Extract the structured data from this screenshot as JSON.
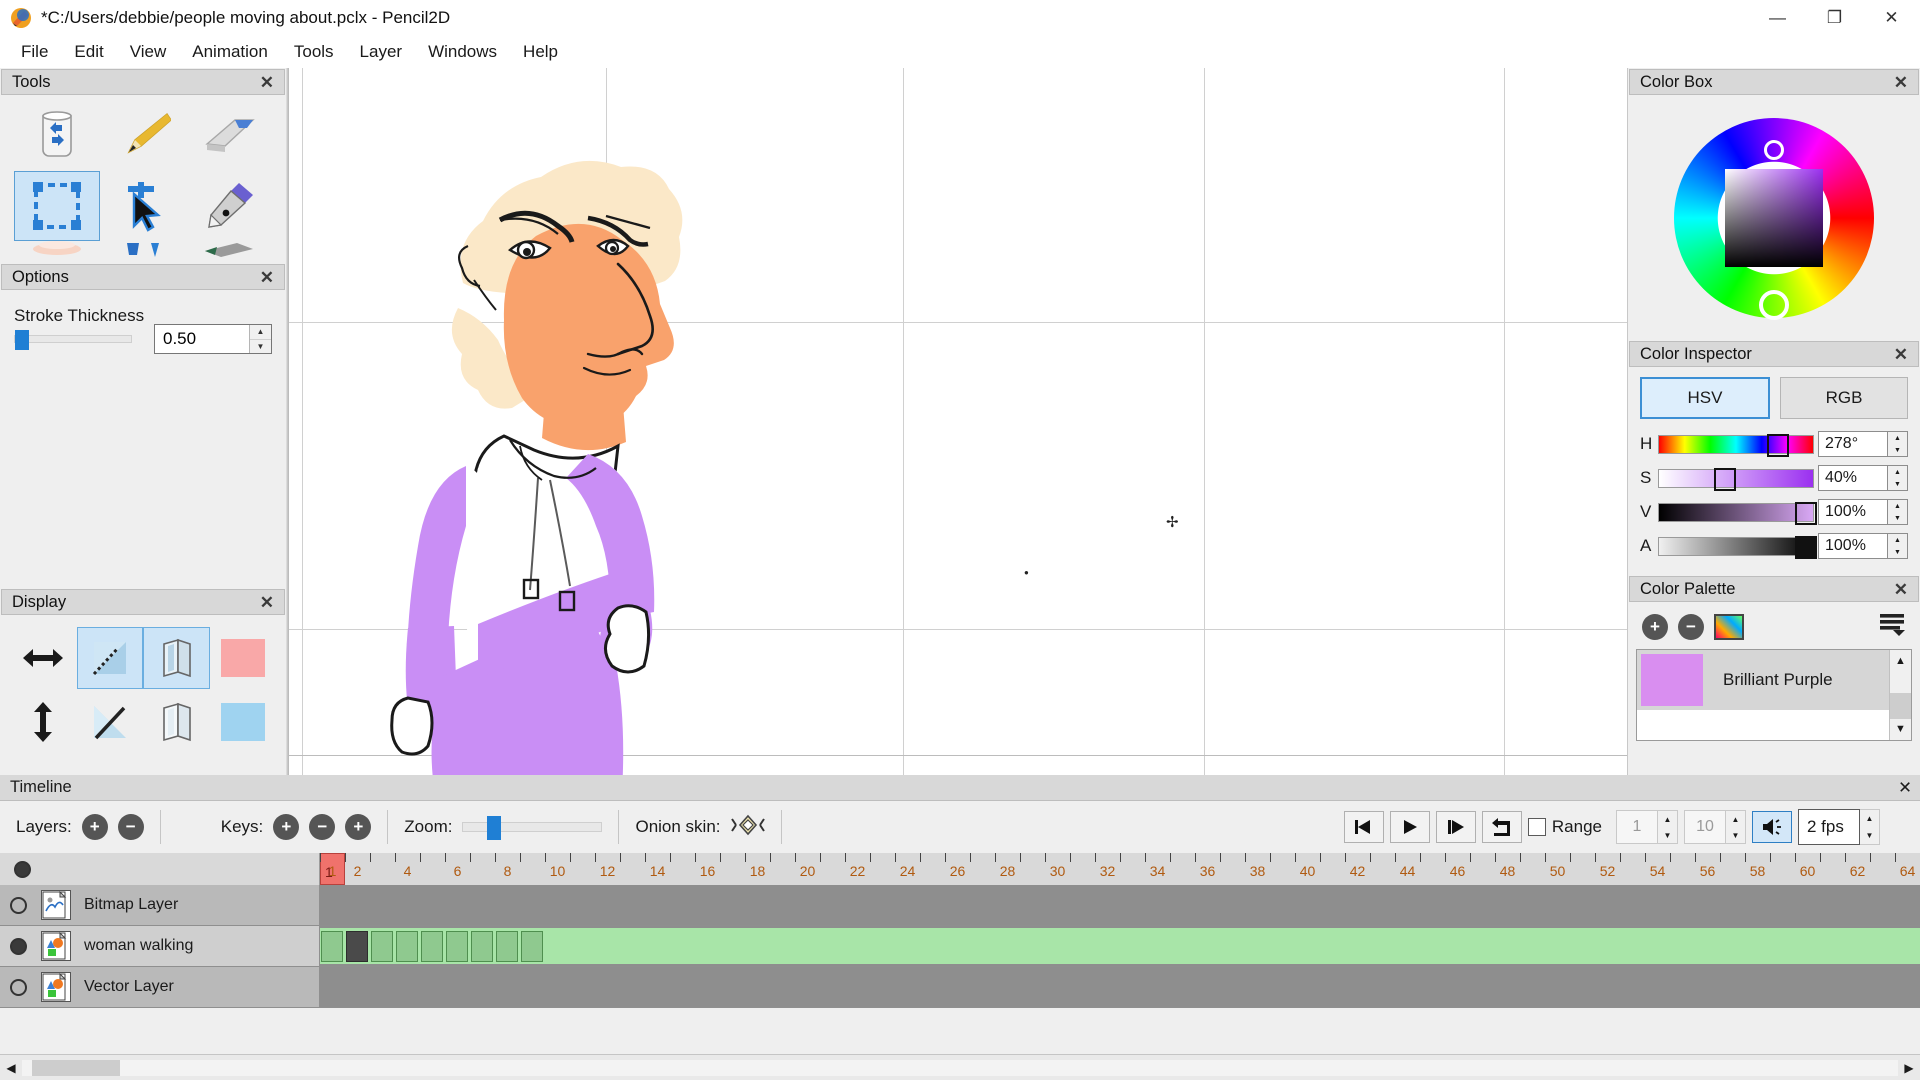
{
  "window": {
    "title": "*C:/Users/debbie/people moving about.pclx - Pencil2D",
    "app_icon": "pencil2d-logo-icon",
    "minimize": "—",
    "maximize": "❐",
    "close": "✕"
  },
  "menubar": [
    {
      "label": "File"
    },
    {
      "label": "Edit"
    },
    {
      "label": "View"
    },
    {
      "label": "Animation"
    },
    {
      "label": "Tools"
    },
    {
      "label": "Layer"
    },
    {
      "label": "Windows"
    },
    {
      "label": "Help"
    }
  ],
  "panels": {
    "tools": {
      "title": "Tools",
      "close": "✕"
    },
    "options": {
      "title": "Options",
      "close": "✕"
    },
    "display": {
      "title": "Display",
      "close": "✕"
    },
    "color_box": {
      "title": "Color Box",
      "close": "✕"
    },
    "color_inspector": {
      "title": "Color Inspector",
      "close": "✕"
    },
    "color_palette": {
      "title": "Color Palette",
      "close": "✕"
    },
    "timeline": {
      "title": "Timeline",
      "close": "✕"
    }
  },
  "tools": [
    {
      "name": "clear-tool",
      "icon": "trash-recycle-icon",
      "selected": false
    },
    {
      "name": "pencil-tool",
      "icon": "pencil-icon",
      "selected": false
    },
    {
      "name": "eraser-tool",
      "icon": "eraser-icon",
      "selected": false
    },
    {
      "name": "select-tool",
      "icon": "select-rectangle-icon",
      "selected": true
    },
    {
      "name": "move-tool",
      "icon": "move-arrow-icon",
      "selected": false
    },
    {
      "name": "pen-tool",
      "icon": "pen-nib-icon",
      "selected": false
    },
    {
      "name": "smudge-tool",
      "icon": "smudge-icon",
      "selected": false
    },
    {
      "name": "bucket-tool",
      "icon": "paint-bucket-icon",
      "selected": false
    },
    {
      "name": "brush-tool",
      "icon": "brush-icon",
      "selected": false
    }
  ],
  "options": {
    "stroke_thickness_label": "Stroke Thickness",
    "stroke_thickness_value": "0.50",
    "slider_position_percent": 2
  },
  "display": {
    "buttons": [
      {
        "name": "flip-horizontal-button",
        "icon": "horizontal-arrows-icon",
        "selected": false
      },
      {
        "name": "onion-skin-previous-button",
        "icon": "onion-prev-icon",
        "selected": true
      },
      {
        "name": "onion-skin-multilayer-prev-button",
        "icon": "layers-prev-icon",
        "selected": true
      },
      {
        "name": "onion-color-red-button",
        "icon": "pink-swatch-icon",
        "selected": false,
        "color": "#f9a8a8"
      },
      {
        "name": "flip-vertical-button",
        "icon": "vertical-arrows-icon",
        "selected": false
      },
      {
        "name": "onion-skin-next-button",
        "icon": "onion-next-icon",
        "selected": false
      },
      {
        "name": "onion-skin-multilayer-next-button",
        "icon": "layers-next-icon",
        "selected": false
      },
      {
        "name": "onion-color-blue-button",
        "icon": "blue-swatch-icon",
        "selected": false,
        "color": "#9fd3f0"
      }
    ]
  },
  "color_box": {
    "hue_marker_label": "ring-selector",
    "square_marker_label": "square-selector"
  },
  "color_inspector": {
    "tabs": [
      {
        "label": "HSV",
        "active": true
      },
      {
        "label": "RGB",
        "active": false
      }
    ],
    "channels": [
      {
        "label": "H",
        "value": "278°",
        "knob_percent": 72
      },
      {
        "label": "S",
        "value": "40%",
        "knob_percent": 38
      },
      {
        "label": "V",
        "value": "100%",
        "knob_percent": 94
      },
      {
        "label": "A",
        "value": "100%",
        "knob_percent": 94
      }
    ]
  },
  "color_palette": {
    "add_label": "+",
    "remove_label": "−",
    "swatch_view_icon": "palette-grid-icon",
    "menu_icon": "hamburger-menu-icon",
    "items": [
      {
        "name": "Brilliant Purple",
        "color": "#d98ef0"
      }
    ],
    "scroll_up": "▲",
    "scroll_down": "▼"
  },
  "canvas": {
    "character": {
      "hair_color": "#fbe8c8",
      "skin_color": "#f9a26c",
      "shirt_color": "#ffffff",
      "clothes_color": "#c98ef5",
      "outline_color": "#1a1a1a"
    },
    "cursor_glyph": "✢"
  },
  "timeline": {
    "layers_label": "Layers:",
    "layers_add": "+",
    "layers_remove": "−",
    "keys_label": "Keys:",
    "keys_add": "+",
    "keys_remove": "−",
    "keys_duplicate": "+",
    "zoom_label": "Zoom:",
    "zoom_knob_percent": 17,
    "onion_skin_label": "Onion skin:",
    "onion_skin_icon": "onion-diamond-icon",
    "playback": {
      "prev_frame": "prev-frame-icon",
      "play": "play-icon",
      "next_frame": "next-frame-icon",
      "loop": "loop-icon",
      "range_label": "Range",
      "range_checked": false,
      "range_start": "1",
      "range_end": "10",
      "sound_icon": "speaker-icon",
      "sound_on": true,
      "fps": "2 fps"
    },
    "current_frame": 1,
    "ruler_numbers": [
      1,
      2,
      4,
      6,
      8,
      10,
      12,
      14,
      16,
      18,
      20,
      22,
      24,
      26,
      28,
      30,
      32,
      34,
      36,
      38,
      40,
      42,
      44,
      46,
      48,
      50,
      52,
      54,
      56,
      58,
      60,
      62,
      64
    ],
    "layers": [
      {
        "name": "Bitmap Layer",
        "type": "bitmap",
        "visible": false,
        "selected": false,
        "keyframes": []
      },
      {
        "name": "woman walking",
        "type": "vector",
        "visible": true,
        "selected": true,
        "keyframes": [
          1,
          2,
          3,
          4,
          5,
          6,
          7,
          8,
          9
        ],
        "dark_keyframe": 2
      },
      {
        "name": "Vector Layer",
        "type": "vector",
        "visible": false,
        "selected": false,
        "keyframes": []
      }
    ]
  }
}
